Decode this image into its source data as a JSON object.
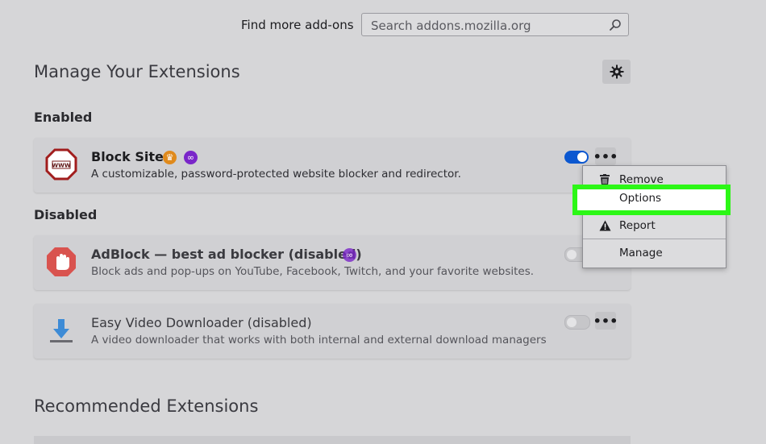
{
  "header": {
    "find_label": "Find more add-ons",
    "search_placeholder": "Search addons.mozilla.org"
  },
  "page_title": "Manage Your Extensions",
  "sections": {
    "enabled": "Enabled",
    "disabled": "Disabled",
    "recommended": "Recommended Extensions"
  },
  "extensions": [
    {
      "name": "Block Site",
      "description": "A customizable, password-protected website blocker and redirector.",
      "enabled": true,
      "icon": "blocksite-octagon-icon"
    },
    {
      "name": "AdBlock — best ad blocker (disabled)",
      "description": "Block ads and pop-ups on YouTube, Facebook, Twitch, and your favorite websites.",
      "enabled": false,
      "icon": "adblock-hand-icon"
    },
    {
      "name": "Easy Video Downloader (disabled)",
      "description": "A video downloader that works with both internal and external download managers",
      "enabled": false,
      "icon": "download-arrow-icon"
    }
  ],
  "context_menu": {
    "items": [
      "Remove",
      "Options",
      "Report",
      "Manage"
    ],
    "highlighted": "Options"
  },
  "colors": {
    "toggle_on": "#0b57d0",
    "highlight": "#2cf716",
    "private_badge": "#7a26c9",
    "recommended_badge": "#e08a1c"
  }
}
